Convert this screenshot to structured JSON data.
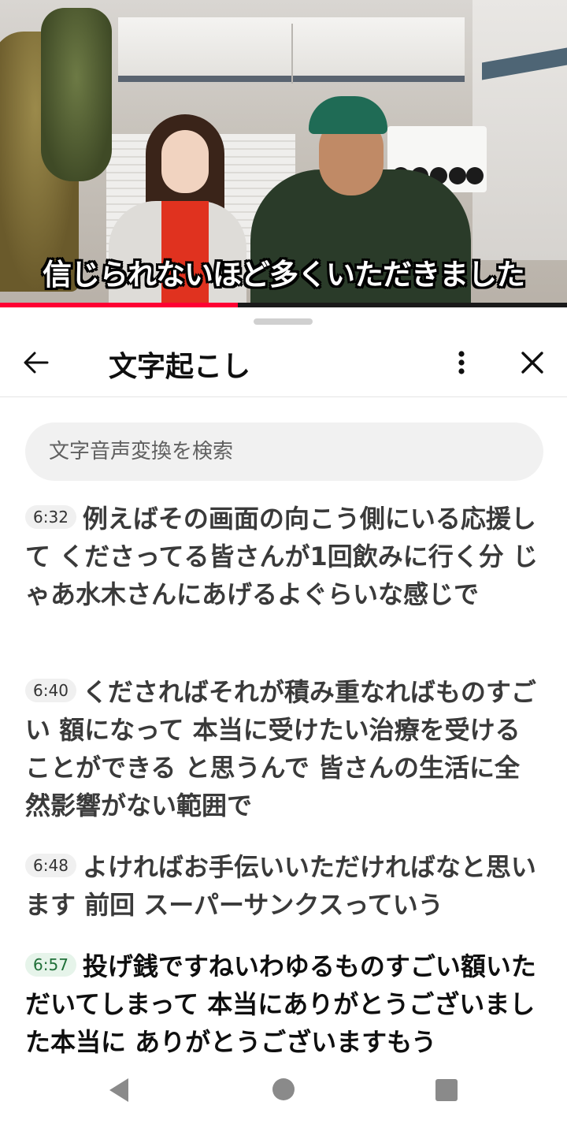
{
  "video": {
    "caption": "信じられないほど多くいただきました",
    "progress_fraction": 0.42,
    "progress_color": "#ff0033"
  },
  "panel": {
    "title": "文字起こし",
    "back_icon": "arrow-left-icon",
    "more_icon": "more-vert-icon",
    "close_icon": "close-icon"
  },
  "search": {
    "placeholder": "文字音声変換を検索"
  },
  "segments": [
    {
      "time": "6:32",
      "text": "例えばその画面の向こう側にいる応援して くださってる皆さんが1回飲みに行く分 じゃあ水木さんにあげるよぐらいな感じで",
      "active": false
    },
    {
      "time": "6:40",
      "text": "くださればそれが積み重なればものすごい 額になって 本当に受けたい治療を受けることができる と思うんで 皆さんの生活に全然影響がない範囲で",
      "active": false
    },
    {
      "time": "6:48",
      "text": "よければお手伝いいただければなと思い ます 前回 スーパーサンクスっていう",
      "active": false
    },
    {
      "time": "6:57",
      "text": "投げ銭ですねいわゆるものすごい額いただいてしまって 本当にありがとうございました本当に ありがとうございますもう",
      "active": true
    }
  ],
  "navbar": {
    "back_icon": "triangle-back-icon",
    "home_icon": "circle-home-icon",
    "recent_icon": "square-recent-icon"
  }
}
